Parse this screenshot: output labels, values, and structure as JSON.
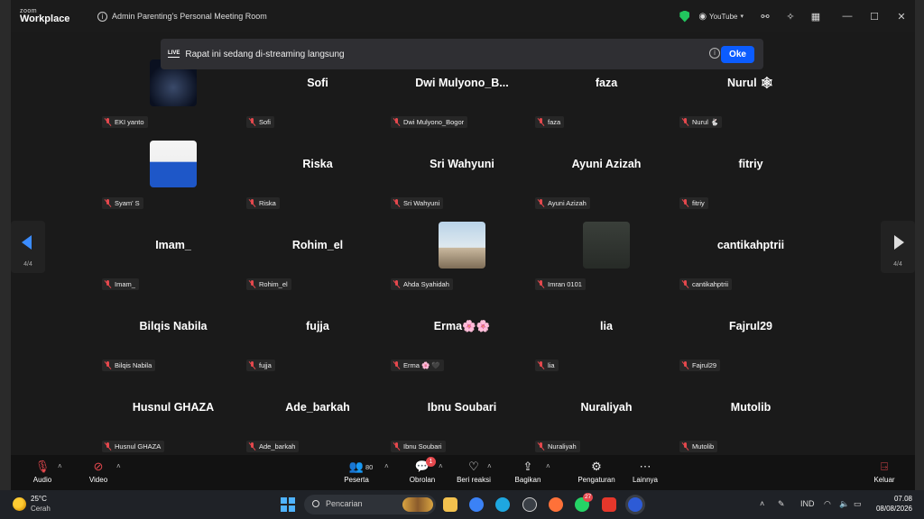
{
  "window": {
    "logo_top": "zoom",
    "logo_bottom": "Workplace",
    "meeting_title": "Admin Parenting's Personal Meeting Room",
    "stream_label": "YouTube"
  },
  "banner": {
    "live": "LIVE",
    "text": "Rapat ini sedang di-streaming langsung",
    "ok": "Oke"
  },
  "gallery": {
    "page": "4/4",
    "participants": [
      {
        "name": "",
        "label": "EKI yanto",
        "avatar": "logo"
      },
      {
        "name": "Sofi",
        "label": "Sofi"
      },
      {
        "name": "Dwi  Mulyono_B...",
        "label": "Dwi Mulyono_Bogor"
      },
      {
        "name": "faza",
        "label": "faza"
      },
      {
        "name": "Nurul 🕸",
        "label": "Nurul 🐇"
      },
      {
        "name": "",
        "label": "Syam' S",
        "avatar": "blue"
      },
      {
        "name": "Riska",
        "label": "Riska"
      },
      {
        "name": "Sri Wahyuni",
        "label": "Sri Wahyuni"
      },
      {
        "name": "Ayuni Azizah",
        "label": "Ayuni Azizah"
      },
      {
        "name": "fitriy",
        "label": "fitriy"
      },
      {
        "name": "Imam_",
        "label": "Imam_"
      },
      {
        "name": "Rohim_el",
        "label": "Rohim_el"
      },
      {
        "name": "",
        "label": "Ahda Syahidah",
        "avatar": "mecca"
      },
      {
        "name": "",
        "label": "Imran 0101",
        "avatar": "dark"
      },
      {
        "name": "cantikahptrii",
        "label": "cantikahptrii"
      },
      {
        "name": "Bilqis Nabila",
        "label": "Bilqis Nabila"
      },
      {
        "name": "fujja",
        "label": "fujja"
      },
      {
        "name": "Erma🌸🌸",
        "label": "Erma 🌸 🖤"
      },
      {
        "name": "lia",
        "label": "lia"
      },
      {
        "name": "Fajrul29",
        "label": "Fajrul29"
      },
      {
        "name": "Husnul GHAZA",
        "label": "Husnul GHAZA"
      },
      {
        "name": "Ade_barkah",
        "label": "Ade_barkah"
      },
      {
        "name": "Ibnu Soubari",
        "label": "Ibnu Soubari"
      },
      {
        "name": "Nuraliyah",
        "label": "Nuraliyah"
      },
      {
        "name": "Mutolib",
        "label": "Mutolib"
      }
    ]
  },
  "toolbar": {
    "audio": "Audio",
    "video": "Video",
    "participants": "Peserta",
    "participants_count": "80",
    "chat": "Obrolan",
    "chat_badge": "1",
    "reactions": "Beri reaksi",
    "share": "Bagikan",
    "settings": "Pengaturan",
    "more": "Lainnya",
    "leave": "Keluar"
  },
  "taskbar": {
    "temp": "25°C",
    "condition": "Cerah",
    "search_placeholder": "Pencarian",
    "app_badge": "27",
    "lang": "IND",
    "time": "07.08",
    "date": "08/08/2026"
  },
  "colors": {
    "accent": "#0b5cff",
    "muted_red": "#e5484d",
    "secure_green": "#22c55e"
  }
}
